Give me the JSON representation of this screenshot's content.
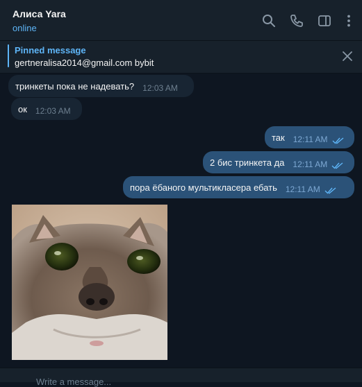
{
  "header": {
    "name": "Алиса Yara",
    "status": "online",
    "icons": [
      "search-icon",
      "phone-icon",
      "sidebar-toggle-icon",
      "more-vertical-icon"
    ]
  },
  "pinned": {
    "title": "Pinned message",
    "text": "gertneralisa2014@gmail.com bybit"
  },
  "messages": [
    {
      "dir": "in",
      "text": "тринкеты пока не надевать?",
      "time": "12:03 AM"
    },
    {
      "dir": "in",
      "text": "ок",
      "time": "12:03 AM"
    },
    {
      "dir": "out",
      "text": "так",
      "time": "12:11 AM",
      "read": true
    },
    {
      "dir": "out",
      "text": "2 бис тринкета да",
      "time": "12:11 AM",
      "read": true
    },
    {
      "dir": "out",
      "text": "пора ёбаного мультикласера ебать",
      "time": "12:11 AM",
      "read": true
    }
  ],
  "photo": {
    "subject": "cat-face-photo"
  },
  "input": {
    "placeholder": "Write a message..."
  },
  "colors": {
    "background": "#0e1621",
    "panel": "#17212b",
    "incoming_bubble": "#182533",
    "outgoing_bubble": "#2b5278",
    "accent": "#5eb5f7"
  }
}
